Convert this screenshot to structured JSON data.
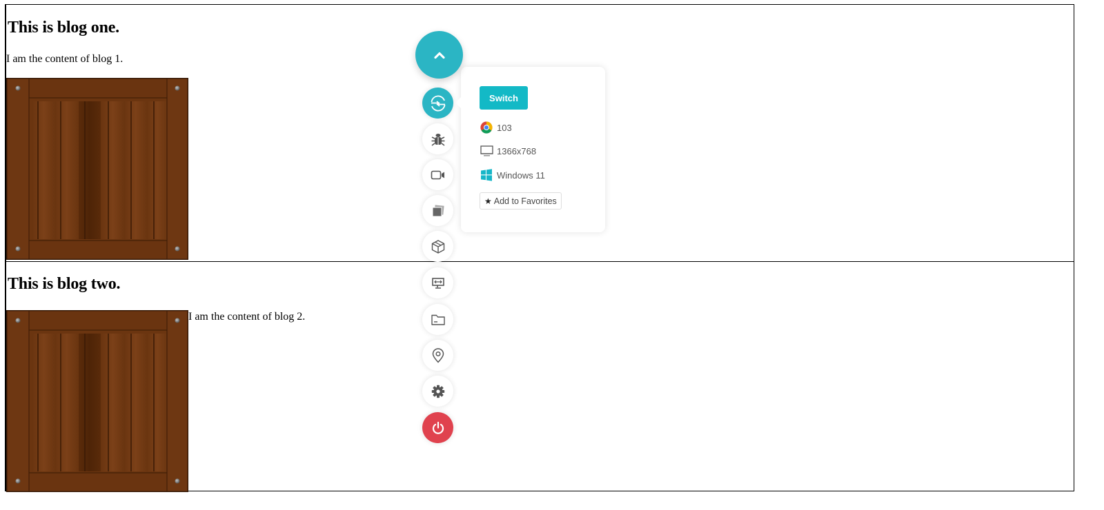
{
  "blogs": [
    {
      "title": "This is blog one.",
      "content": "I am the content of blog 1.",
      "image": "wooden-crate"
    },
    {
      "title": "This is blog two.",
      "content": "I am the content of blog 2.",
      "image": "wooden-crate"
    }
  ],
  "toolbar": {
    "collapse_icon": "chevron-up-icon",
    "tools": [
      {
        "name": "switch-browser",
        "icon": "switch-icon",
        "active": true
      },
      {
        "name": "bug-report",
        "icon": "bug-icon"
      },
      {
        "name": "record-video",
        "icon": "video-camera-icon"
      },
      {
        "name": "screenshot-gallery",
        "icon": "gallery-icon"
      },
      {
        "name": "3d-cube",
        "icon": "cube-icon"
      },
      {
        "name": "resolution",
        "icon": "monitor-resize-icon"
      },
      {
        "name": "files",
        "icon": "folder-icon"
      },
      {
        "name": "geolocation",
        "icon": "location-pin-icon"
      },
      {
        "name": "settings",
        "icon": "gear-icon"
      },
      {
        "name": "end-session",
        "icon": "power-icon"
      }
    ],
    "colors": {
      "accent": "#2bb5c4",
      "power": "#e0424e",
      "switch_button": "#13b9c6"
    }
  },
  "popup": {
    "switch_label": "Switch",
    "browser_version": "103",
    "browser_icon": "chrome-icon",
    "resolution": "1366x768",
    "resolution_icon": "monitor-icon",
    "os": "Windows 11",
    "os_icon": "windows-icon",
    "favorites_label": "Add to Favorites",
    "favorites_icon": "star-icon"
  }
}
